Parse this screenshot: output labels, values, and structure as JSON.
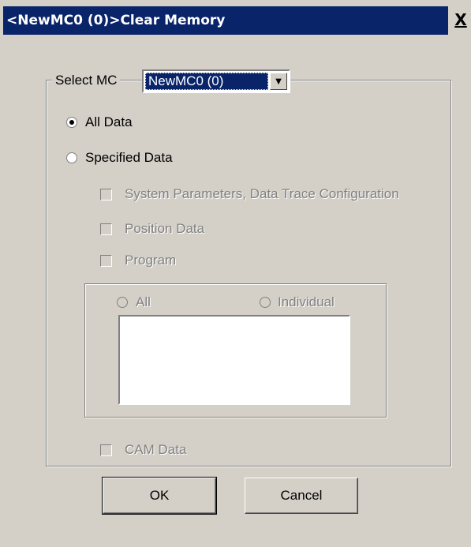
{
  "window": {
    "title": "<NewMC0 (0)>Clear Memory",
    "close_glyph": "X"
  },
  "select_mc": {
    "label": "Select MC",
    "value": "NewMC0 (0)"
  },
  "data_mode": {
    "all_data_label": "All Data",
    "specified_data_label": "Specified Data",
    "selected": "all_data"
  },
  "options": {
    "system_params_label": "System Parameters, Data Trace Configuration",
    "position_data_label": "Position Data",
    "program_label": "Program",
    "program_all_label": "All",
    "program_individual_label": "Individual",
    "cam_data_label": "CAM Data"
  },
  "buttons": {
    "ok_label": "OK",
    "cancel_label": "Cancel"
  }
}
